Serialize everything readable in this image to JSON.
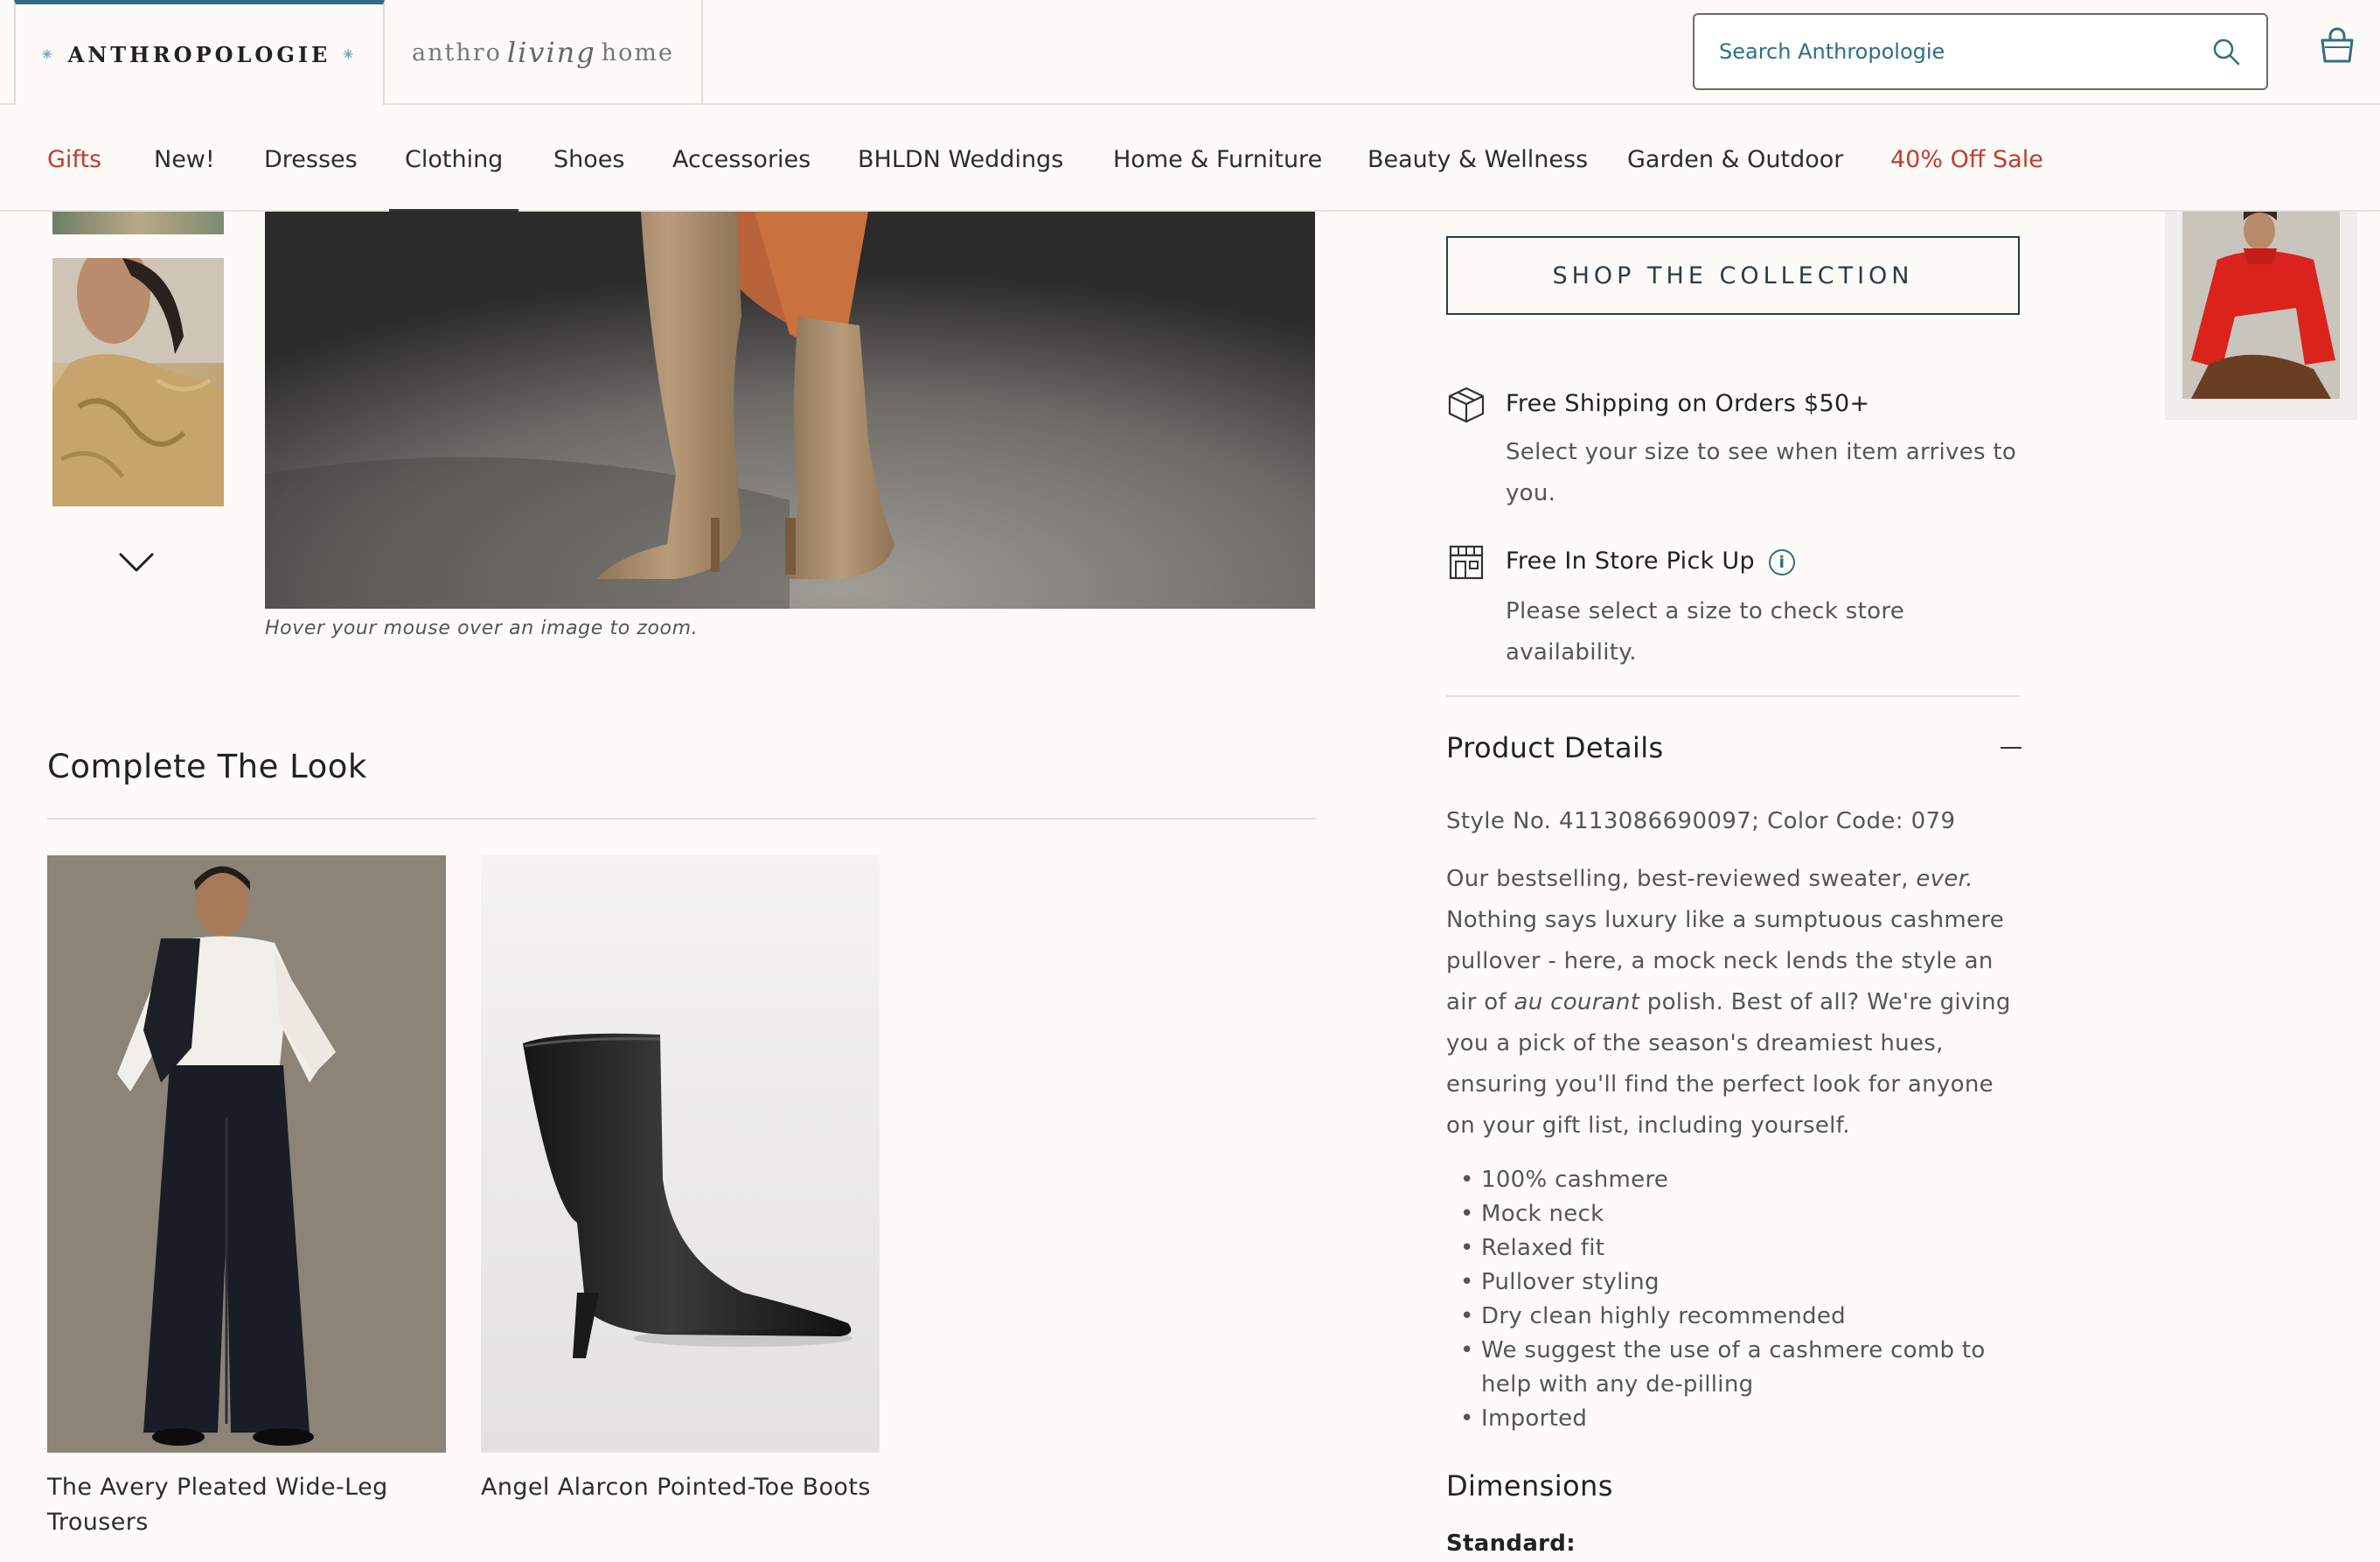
{
  "header": {
    "brand_primary": "ANTHROPOLOGIE",
    "brand_secondary_left": "anthro",
    "brand_secondary_script": "living",
    "brand_secondary_right": "home",
    "search_placeholder": "Search Anthropologie",
    "search_icon": "search-icon",
    "bag_icon": "shopping-bag-icon"
  },
  "nav": {
    "items": [
      {
        "label": "Gifts"
      },
      {
        "label": "New!"
      },
      {
        "label": "Dresses"
      },
      {
        "label": "Clothing"
      },
      {
        "label": "Shoes"
      },
      {
        "label": "Accessories"
      },
      {
        "label": "BHLDN Weddings"
      },
      {
        "label": "Home & Furniture"
      },
      {
        "label": "Beauty & Wellness"
      },
      {
        "label": "Garden & Outdoor"
      },
      {
        "label": "40% Off Sale"
      }
    ],
    "active": "Clothing",
    "highlight_color": "#c23c2e"
  },
  "gallery": {
    "zoom_hint": "Hover your mouse over an image to zoom.",
    "next_icon": "chevron-down-icon"
  },
  "complete_the_look": {
    "title": "Complete The Look",
    "items": [
      {
        "name": "The Avery Pleated Wide-Leg Trousers"
      },
      {
        "name": "Angel Alarcon Pointed-Toe Boots"
      }
    ]
  },
  "product": {
    "shop_collection": "SHOP THE COLLECTION",
    "shipping_title": "Free Shipping on Orders $50+",
    "shipping_sub": "Select your size to see when item arrives to you.",
    "pickup_title": "Free In Store Pick Up",
    "pickup_sub": "Please select a size to check store availability.",
    "details_title": "Product Details",
    "style_line": "Style No. 4113086690097; Color Code: 079",
    "desc_part1": "Our bestselling, best-reviewed sweater, ",
    "desc_em1": "ever.",
    "desc_part2": " Nothing says luxury like a sumptuous cashmere pullover - here, a mock neck lends the style an air of ",
    "desc_em2": "au courant",
    "desc_part3": " polish. Best of all? We're giving you a pick of the season's dreamiest hues, ensuring you'll find the perfect look for anyone on your gift list, including yourself.",
    "features": [
      "100% cashmere",
      "Mock neck",
      "Relaxed fit",
      "Pullover styling",
      "Dry clean highly recommended",
      "We suggest the use of a cashmere comb to help with any de-pilling",
      "Imported"
    ],
    "dimensions_title": "Dimensions",
    "dimensions_sub": "Standard:"
  },
  "colors": {
    "accent": "#2f6f86",
    "sale_red": "#c23c2e",
    "button_border": "#2d3a4a"
  }
}
